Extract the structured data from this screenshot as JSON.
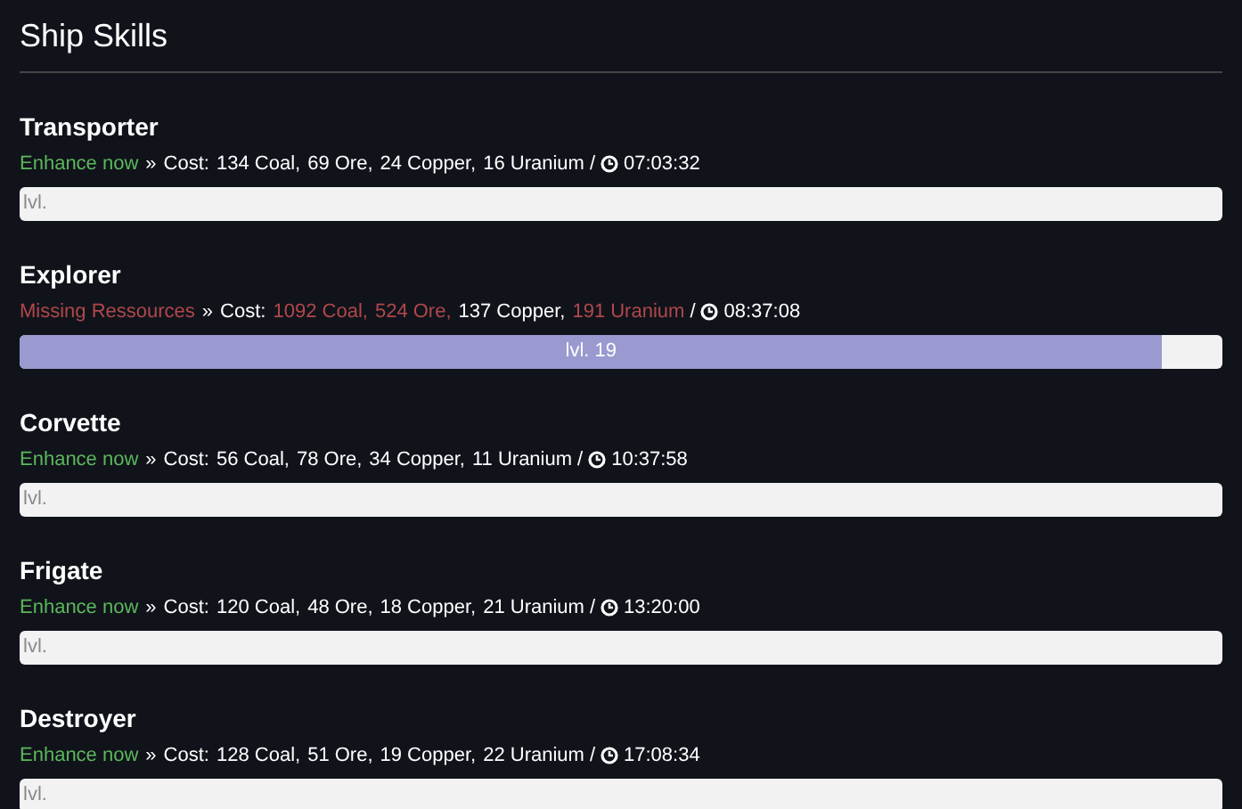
{
  "title": "Ship Skills",
  "skills": [
    {
      "name": "Transporter",
      "status": {
        "kind": "ready",
        "text": "Enhance now"
      },
      "separator": "»",
      "cost_label": "Cost:",
      "costs": [
        {
          "text": "134 Coal,",
          "missing": false
        },
        {
          "text": "69 Ore,",
          "missing": false
        },
        {
          "text": "24 Copper,",
          "missing": false
        },
        {
          "text": "16 Uranium",
          "missing": false
        }
      ],
      "slash": "/",
      "time": "07:03:32",
      "level": 0,
      "level_label": "lvl."
    },
    {
      "name": "Explorer",
      "status": {
        "kind": "missing",
        "text": "Missing Ressources"
      },
      "separator": "»",
      "cost_label": "Cost:",
      "costs": [
        {
          "text": "1092 Coal,",
          "missing": true
        },
        {
          "text": "524 Ore,",
          "missing": true
        },
        {
          "text": "137 Copper,",
          "missing": false
        },
        {
          "text": "191 Uranium",
          "missing": true
        }
      ],
      "slash": "/",
      "time": "08:37:08",
      "level": 0.95,
      "level_label": "lvl. 19"
    },
    {
      "name": "Corvette",
      "status": {
        "kind": "ready",
        "text": "Enhance now"
      },
      "separator": "»",
      "cost_label": "Cost:",
      "costs": [
        {
          "text": "56 Coal,",
          "missing": false
        },
        {
          "text": "78 Ore,",
          "missing": false
        },
        {
          "text": "34 Copper,",
          "missing": false
        },
        {
          "text": "11 Uranium",
          "missing": false
        }
      ],
      "slash": "/",
      "time": "10:37:58",
      "level": 0,
      "level_label": "lvl."
    },
    {
      "name": "Frigate",
      "status": {
        "kind": "ready",
        "text": "Enhance now"
      },
      "separator": "»",
      "cost_label": "Cost:",
      "costs": [
        {
          "text": "120 Coal,",
          "missing": false
        },
        {
          "text": "48 Ore,",
          "missing": false
        },
        {
          "text": "18 Copper,",
          "missing": false
        },
        {
          "text": "21 Uranium",
          "missing": false
        }
      ],
      "slash": "/",
      "time": "13:20:00",
      "level": 0,
      "level_label": "lvl."
    },
    {
      "name": "Destroyer",
      "status": {
        "kind": "ready",
        "text": "Enhance now"
      },
      "separator": "»",
      "cost_label": "Cost:",
      "costs": [
        {
          "text": "128 Coal,",
          "missing": false
        },
        {
          "text": "51 Ore,",
          "missing": false
        },
        {
          "text": "19 Copper,",
          "missing": false
        },
        {
          "text": "22 Uranium",
          "missing": false
        }
      ],
      "slash": "/",
      "time": "17:08:34",
      "level": 0,
      "level_label": "lvl."
    }
  ]
}
